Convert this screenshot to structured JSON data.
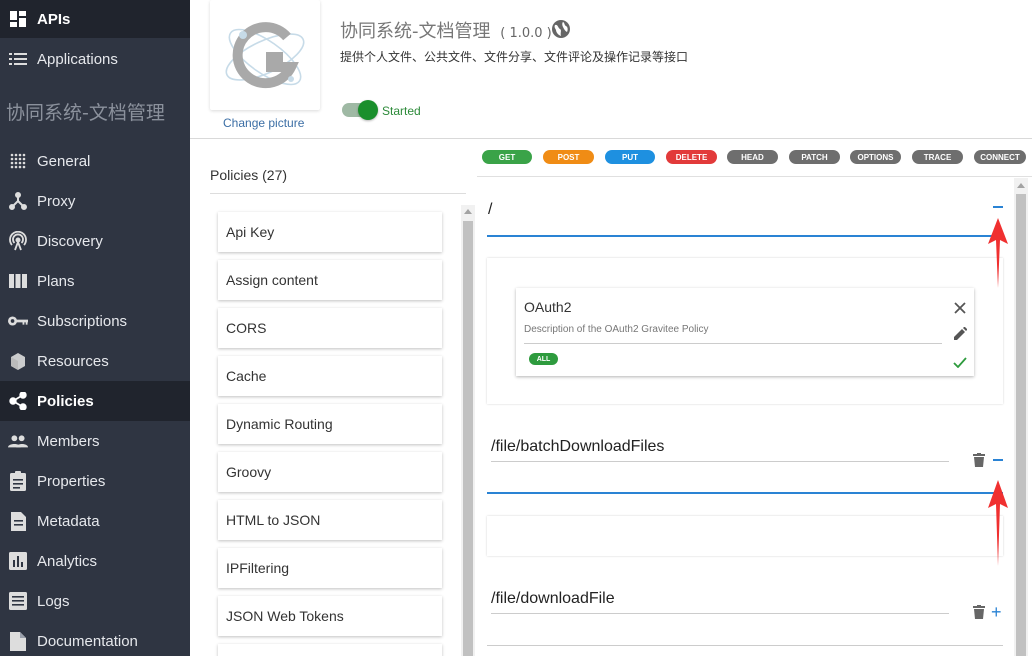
{
  "sidebar": {
    "top": [
      {
        "label": "APIs",
        "icon": "dashboard-icon"
      },
      {
        "label": "Applications",
        "icon": "list-icon"
      }
    ],
    "app_title": "协同系统-文档管理",
    "items": [
      {
        "label": "General",
        "icon": "grid-dots-icon"
      },
      {
        "label": "Proxy",
        "icon": "fork-icon"
      },
      {
        "label": "Discovery",
        "icon": "broadcast-icon"
      },
      {
        "label": "Plans",
        "icon": "columns-icon"
      },
      {
        "label": "Subscriptions",
        "icon": "key-icon"
      },
      {
        "label": "Resources",
        "icon": "cube-icon"
      },
      {
        "label": "Policies",
        "icon": "share-icon"
      },
      {
        "label": "Members",
        "icon": "people-icon"
      },
      {
        "label": "Properties",
        "icon": "clipboard-icon"
      },
      {
        "label": "Metadata",
        "icon": "document-icon"
      },
      {
        "label": "Analytics",
        "icon": "bar-chart-icon"
      },
      {
        "label": "Logs",
        "icon": "list-box-icon"
      },
      {
        "label": "Documentation",
        "icon": "book-icon"
      }
    ],
    "active": "Policies"
  },
  "header": {
    "title": "协同系统-文档管理",
    "version": "( 1.0.0 )",
    "description": "提供个人文件、公共文件、文件分享、文件评论及操作记录等接口",
    "change_picture": "Change picture",
    "status": "Started"
  },
  "policies": {
    "heading": "Policies (27)",
    "items": [
      "Api Key",
      "Assign content",
      "CORS",
      "Cache",
      "Dynamic Routing",
      "Groovy",
      "HTML to JSON",
      "IPFiltering",
      "JSON Web Tokens"
    ]
  },
  "methods": [
    {
      "label": "GET",
      "color": "#3aa348"
    },
    {
      "label": "POST",
      "color": "#f08c15"
    },
    {
      "label": "PUT",
      "color": "#1e90e0"
    },
    {
      "label": "DELETE",
      "color": "#e23a3a"
    },
    {
      "label": "HEAD",
      "color": "#6e6e6e"
    },
    {
      "label": "PATCH",
      "color": "#6e6e6e"
    },
    {
      "label": "OPTIONS",
      "color": "#6e6e6e"
    },
    {
      "label": "TRACE",
      "color": "#6e6e6e"
    },
    {
      "label": "CONNECT",
      "color": "#6e6e6e"
    }
  ],
  "flows": [
    {
      "path": "/",
      "expanded": true
    },
    {
      "path": "/file/batchDownloadFiles",
      "expanded": true
    },
    {
      "path": "/file/downloadFile",
      "expanded": false
    }
  ],
  "oauth": {
    "title": "OAuth2",
    "description": "Description of the OAuth2 Gravitee Policy",
    "badge": "ALL"
  }
}
